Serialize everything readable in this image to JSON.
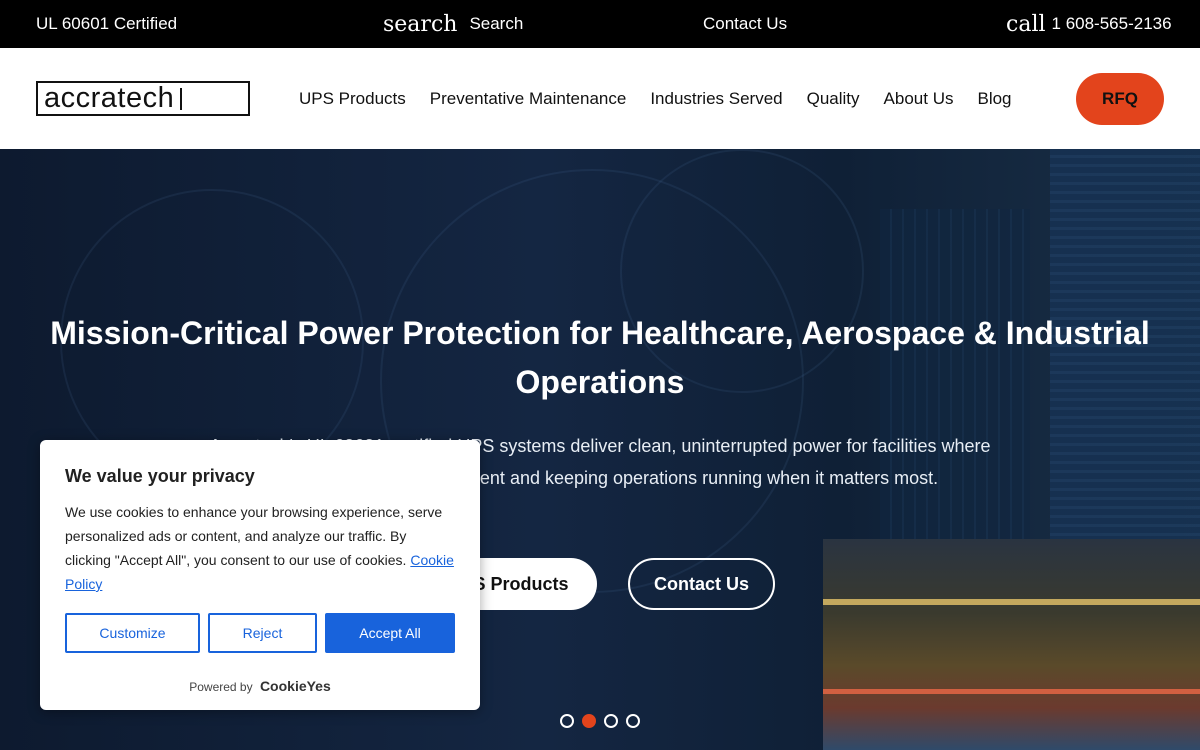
{
  "topbar": {
    "certification": "UL 60601 Certified",
    "search_icon": "search",
    "search_label": "Search",
    "contact_label": "Contact Us",
    "phone_icon": "call",
    "phone": "1 608-565-2136"
  },
  "header": {
    "logo_text": "accratech",
    "nav": [
      "UPS Products",
      "Preventative Maintenance",
      "Industries Served",
      "Quality",
      "About Us",
      "Blog"
    ],
    "rfq_label": "RFQ"
  },
  "hero": {
    "title": "Mission-Critical Power Protection for Healthcare, Aerospace & Industrial Operations",
    "subtitle": "Accratech's UL 60601 certified UPS systems deliver clean, uninterrupted power for facilities where protecting sensitive equipment and keeping operations running when it matters most.",
    "primary_button": "UPS Products",
    "secondary_button": "Contact Us",
    "slides": 4,
    "active_slide": 2
  },
  "cookie_banner": {
    "title": "We value your privacy",
    "body": "We use cookies to enhance your browsing experience, serve personalized ads or content, and analyze our traffic. By clicking \"Accept All\", you consent to our use of cookies.",
    "policy_link": "Cookie Policy",
    "customize": "Customize",
    "reject": "Reject",
    "accept": "Accept All",
    "powered_by": "Powered by",
    "brand": "CookieYes"
  },
  "colors": {
    "accent": "#e3441c",
    "cookie_blue": "#1863dc",
    "topbar": "#000000"
  }
}
